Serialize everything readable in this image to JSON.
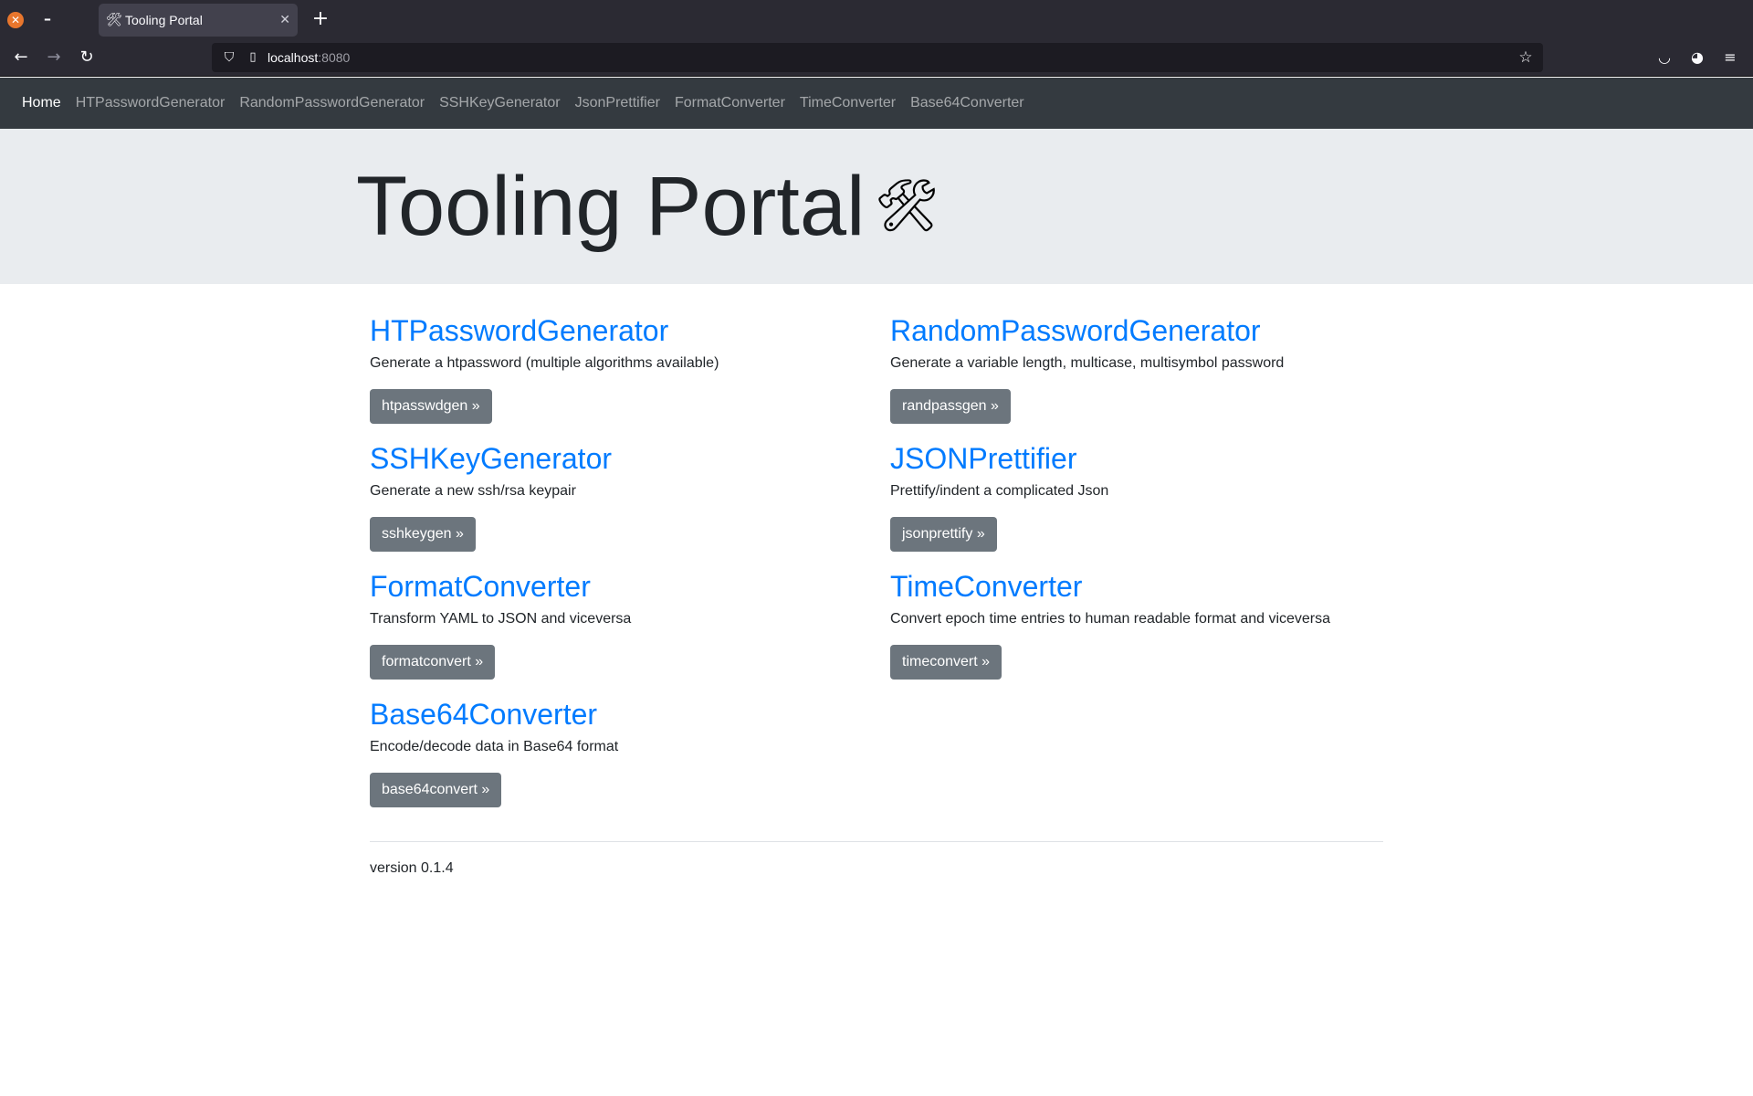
{
  "browser": {
    "tab": {
      "icon": "hammer-and-wrench-icon",
      "title": "Tooling Portal"
    },
    "url": {
      "host": "localhost",
      "port": ":8080"
    }
  },
  "navbar": {
    "items": [
      {
        "label": "Home",
        "active": true
      },
      {
        "label": "HTPasswordGenerator"
      },
      {
        "label": "RandomPasswordGenerator"
      },
      {
        "label": "SSHKeyGenerator"
      },
      {
        "label": "JsonPrettifier"
      },
      {
        "label": "FormatConverter"
      },
      {
        "label": "TimeConverter"
      },
      {
        "label": "Base64Converter"
      }
    ]
  },
  "jumbotron": {
    "title": "Tooling Portal",
    "icon": "🛠"
  },
  "tools": [
    {
      "title": "HTPasswordGenerator",
      "description": "Generate a htpassword (multiple algorithms available)",
      "button": "htpasswdgen »"
    },
    {
      "title": "RandomPasswordGenerator",
      "description": "Generate a variable length, multicase, multisymbol password",
      "button": "randpassgen »"
    },
    {
      "title": "SSHKeyGenerator",
      "description": "Generate a new ssh/rsa keypair",
      "button": "sshkeygen »"
    },
    {
      "title": "JSONPrettifier",
      "description": "Prettify/indent a complicated Json",
      "button": "jsonprettify »"
    },
    {
      "title": "FormatConverter",
      "description": "Transform YAML to JSON and viceversa",
      "button": "formatconvert »"
    },
    {
      "title": "TimeConverter",
      "description": "Convert epoch time entries to human readable format and viceversa",
      "button": "timeconvert »"
    },
    {
      "title": "Base64Converter",
      "description": "Encode/decode data in Base64 format",
      "button": "base64convert »"
    }
  ],
  "footer": {
    "version": "version 0.1.4"
  },
  "colors": {
    "link": "#007bff",
    "button": "#6c757d",
    "navbar": "#343a40",
    "jumbotron": "#e9ecef"
  }
}
